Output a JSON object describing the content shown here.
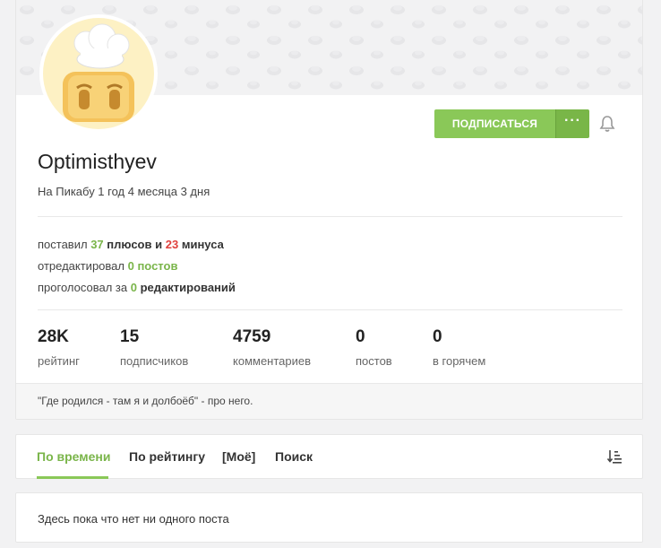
{
  "profile": {
    "username": "Optimisthyev",
    "tenure": "На Пикабу 1 год 4 месяца 3 дня",
    "subscribe_label": "ПОДПИСАТЬСЯ",
    "more_label": "···",
    "avatar_icon": "toaster-chef-avatar",
    "bell_icon": "bell-icon"
  },
  "activity": {
    "line1": {
      "prefix": "поставил",
      "plus_count": "37",
      "plus_word": "плюсов",
      "conj": "и",
      "minus_count": "23",
      "minus_word": "минуса"
    },
    "line2": {
      "prefix": "отредактировал",
      "value": "0 постов"
    },
    "line3": {
      "prefix": "проголосовал за",
      "value": "0",
      "suffix": "редактирований"
    }
  },
  "stats": [
    {
      "value": "28K",
      "label": "рейтинг"
    },
    {
      "value": "15",
      "label": "подписчиков"
    },
    {
      "value": "4759",
      "label": "комментариев"
    },
    {
      "value": "0",
      "label": "постов"
    },
    {
      "value": "0",
      "label": "в горячем"
    }
  ],
  "quote": "\"Где родился - там я и долбоёб\" - про него.",
  "tabs": [
    {
      "label": "По времени",
      "active": true
    },
    {
      "label": "По рейтингу",
      "active": false
    },
    {
      "label": "[Моё]",
      "active": false
    },
    {
      "label": "Поиск",
      "active": false
    }
  ],
  "empty_message": "Здесь пока что нет ни одного поста",
  "colors": {
    "accent": "#8ac858",
    "plus": "#7ab54a",
    "minus": "#e0413d"
  }
}
